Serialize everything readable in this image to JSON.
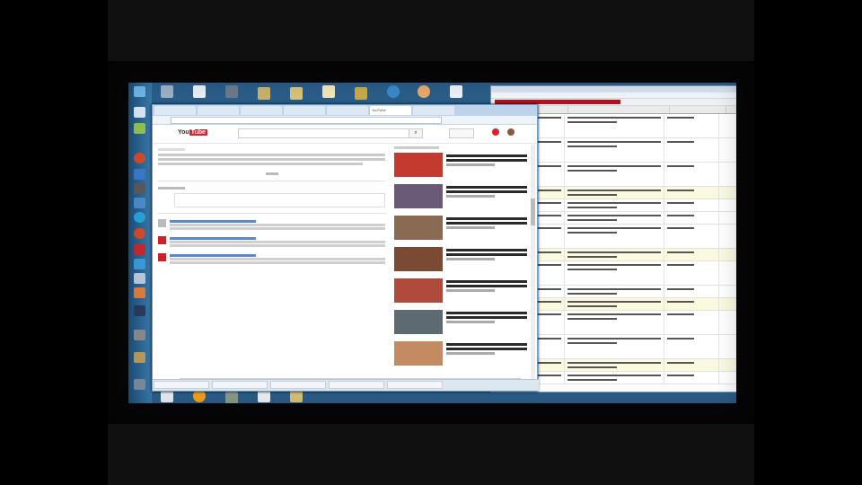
{
  "browser": {
    "tabs": [
      "",
      "",
      "",
      "",
      "",
      "YouTube",
      ""
    ],
    "active_tab_index": 5
  },
  "youtube": {
    "logo_you": "You",
    "logo_tube": "Tube",
    "search_icon": "search-icon",
    "upload_icon": "upload-icon",
    "notification_icon": "bell-icon"
  },
  "colors": {
    "desktop": "#2a5d88",
    "taskbar": "#2f6798",
    "youtube_red": "#d8232a",
    "sheet_highlight": "#fbfadf",
    "toolbar_red": "#b5121b"
  },
  "sidebar_thumbs": [
    "#c43a2e",
    "#6a5a78",
    "#8a6a52",
    "#7a4a32",
    "#b04a3a",
    "#5e6a72",
    "#c48a62"
  ],
  "taskbar_icons": [
    "#d9e6f0",
    "#8fc24a",
    "#d24a2a",
    "#3a78c8",
    "#5a5a5a",
    "#4a8acb",
    "#26a3d8",
    "#d24a2a",
    "#c8282a",
    "#3a9ad8",
    "#b8c8d8",
    "#e07a3a",
    "#2a3a5a",
    "#8a8a8a",
    "#b89a5a"
  ],
  "desktop_icons": [
    "recycle-bin-icon",
    "document-icon",
    "archive-icon",
    "folder-icon",
    "folder-icon",
    "document-icon",
    "folder-icon",
    "globe-icon",
    "media-icon",
    "document-icon"
  ]
}
